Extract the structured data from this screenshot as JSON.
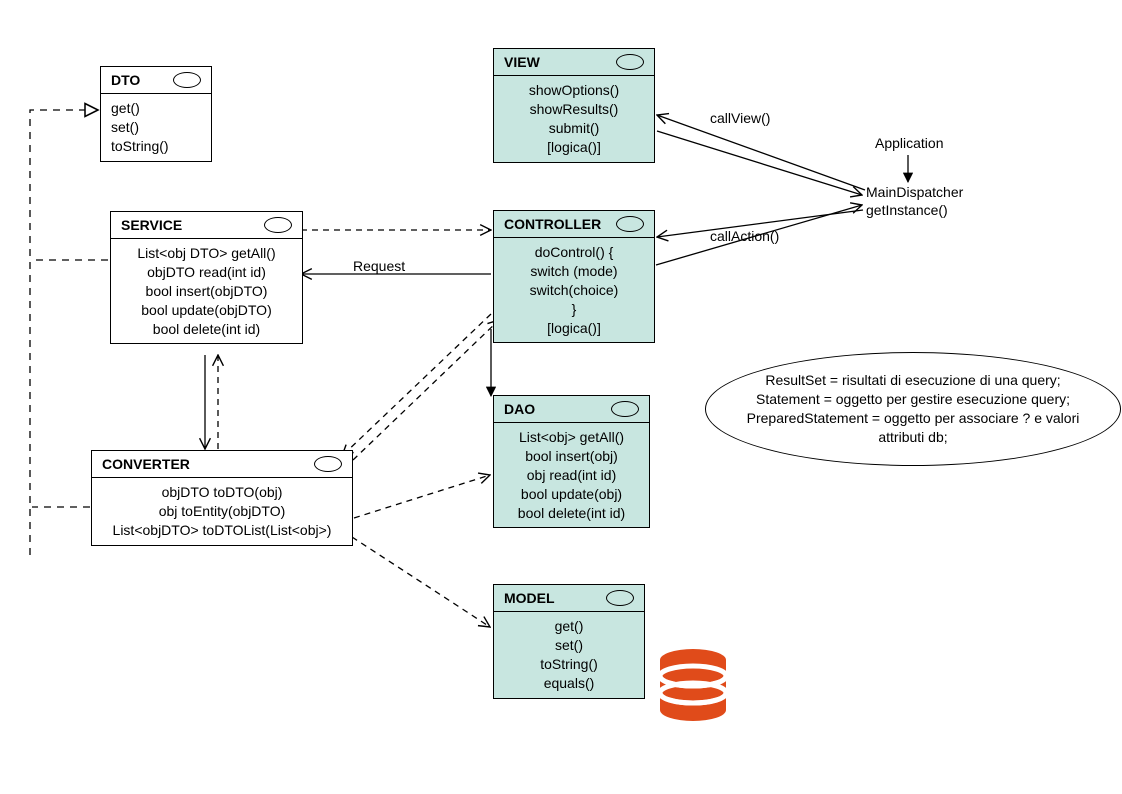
{
  "dto": {
    "title": "DTO",
    "m1": "get()",
    "m2": "set()",
    "m3": "toString()"
  },
  "view": {
    "title": "VIEW",
    "m1": "showOptions()",
    "m2": "showResults()",
    "m3": "submit()",
    "m4": "[logica()]"
  },
  "service": {
    "title": "SERVICE",
    "m1": "List<obj DTO> getAll()",
    "m2": "objDTO read(int id)",
    "m3": "bool insert(objDTO)",
    "m4": "bool update(objDTO)",
    "m5": "bool delete(int id)"
  },
  "controller": {
    "title": "CONTROLLER",
    "m1": "doControl() {",
    "m2": "switch (mode)",
    "m3": "switch(choice)",
    "m4": "}",
    "m5": "[logica()]"
  },
  "converter": {
    "title": "CONVERTER",
    "m1": "objDTO toDTO(obj)",
    "m2": "obj toEntity(objDTO)",
    "m3": "List<objDTO> toDTOList(List<obj>)"
  },
  "dao": {
    "title": "DAO",
    "m1": "List<obj> getAll()",
    "m2": "bool insert(obj)",
    "m3": "obj read(int id)",
    "m4": "bool update(obj)",
    "m5": "bool delete(int id)"
  },
  "model": {
    "title": "MODEL",
    "m1": "get()",
    "m2": "set()",
    "m3": "toString()",
    "m4": "equals()"
  },
  "labels": {
    "callView": "callView()",
    "callAction": "callAction()",
    "request": "Request",
    "application": "Application",
    "mainDispatcher": "MainDispatcher",
    "getInstance": "getInstance()"
  },
  "note": {
    "l1": "ResultSet = risultati di esecuzione di una query;",
    "l2": "Statement = oggetto per gestire esecuzione query;",
    "l3": "PreparedStatement = oggetto per associare ? e valori",
    "l4": "attributi db;"
  },
  "colors": {
    "teal": "#c8e6e0",
    "db": "#e04b1a"
  }
}
